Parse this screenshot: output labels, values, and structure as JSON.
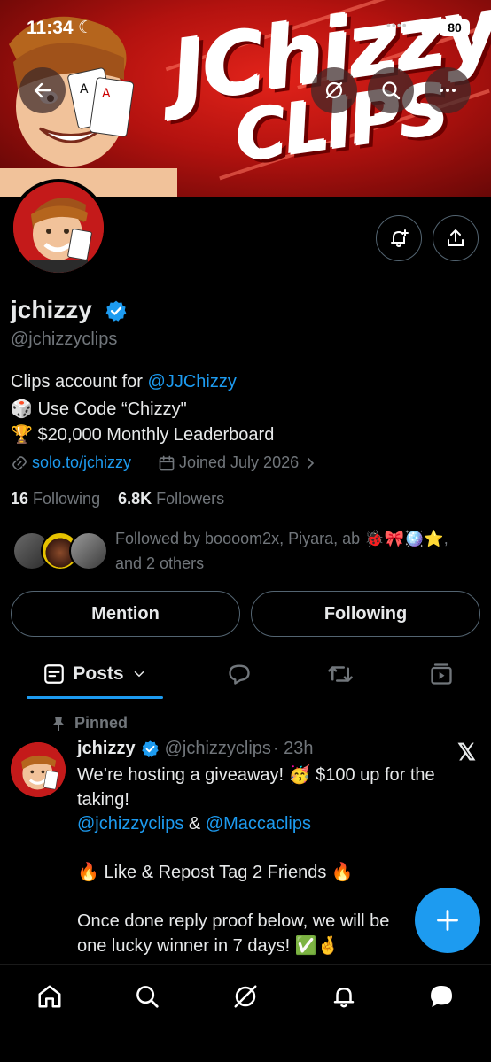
{
  "status_bar": {
    "time": "11:34",
    "battery": "80"
  },
  "profile": {
    "display_name": "jchizzy",
    "handle": "@jchizzyclips",
    "banner_title_line1": "JChizzy",
    "banner_title_line2": "CLIPS",
    "bio_line1_prefix": "Clips account for ",
    "bio_line1_mention": "@JJChizzy",
    "bio_line2": "🎲 Use Code “Chizzy\"",
    "bio_line3": "🏆 $20,000 Monthly Leaderboard",
    "website": "solo.to/jchizzy",
    "joined": "Joined July 2026",
    "following_count": "16",
    "following_label": "Following",
    "followers_count": "6.8K",
    "followers_label": "Followers",
    "followed_by_line1": "Followed by boooom2x, Piyara, ab 🐞🎀🪩⭐,",
    "followed_by_line2": "and 2 others"
  },
  "actions": {
    "mention": "Mention",
    "following": "Following"
  },
  "tabs": {
    "posts": "Posts"
  },
  "post": {
    "pinned_label": "Pinned",
    "author_name": "jchizzy",
    "author_handle": "@jchizzyclips",
    "time": "· 23h",
    "line1": "We’re hosting a giveaway! 🥳 $100 up for the",
    "line2": "taking!",
    "mention1": "@jchizzyclips",
    "amp": " & ",
    "mention2": "@Maccaclips",
    "line4": "🔥 Like & Repost Tag 2 Friends 🔥",
    "line5": "Once done reply proof below, we will be",
    "line6": "one lucky winner in 7 days!  ✅🤞"
  },
  "colors": {
    "accent": "#1d9bf0",
    "muted": "#71767b",
    "banner_red": "#c41a1a"
  }
}
